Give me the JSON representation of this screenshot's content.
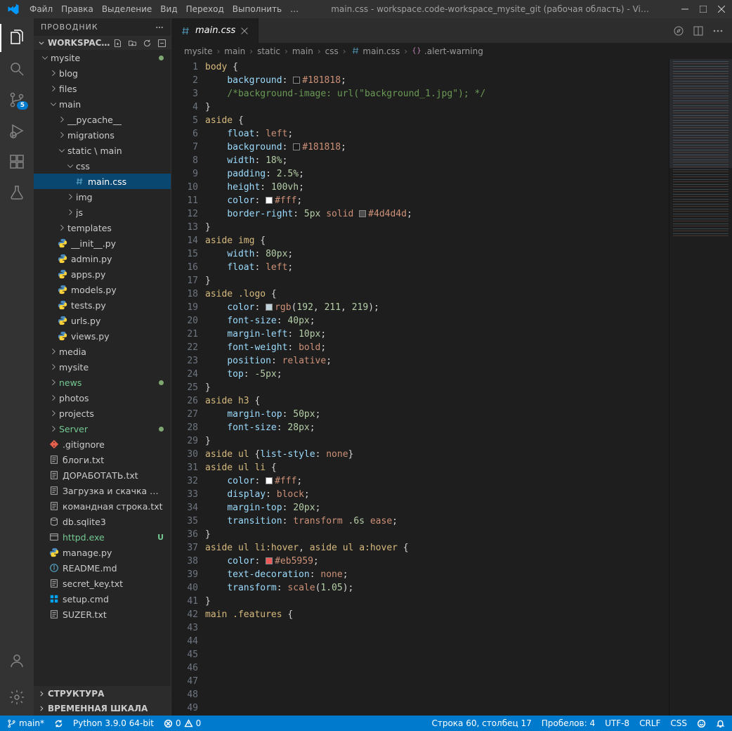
{
  "titlebar": {
    "menus": [
      "Файл",
      "Правка",
      "Выделение",
      "Вид",
      "Переход",
      "Выполнить",
      "…"
    ],
    "title": "main.css - workspace.code-workspace_mysite_git (рабочая область) - Vi…"
  },
  "activity": {
    "scm_badge": "5"
  },
  "sidebar": {
    "title": "ПРОВОДНИК",
    "workspace_label": "WORKSPAC…",
    "tree": [
      {
        "indent": 0,
        "type": "folder-open",
        "label": "mysite",
        "mod": true
      },
      {
        "indent": 1,
        "type": "folder",
        "label": "blog"
      },
      {
        "indent": 1,
        "type": "folder",
        "label": "files"
      },
      {
        "indent": 1,
        "type": "folder-open",
        "label": "main"
      },
      {
        "indent": 2,
        "type": "folder",
        "label": "__pycache__"
      },
      {
        "indent": 2,
        "type": "folder",
        "label": "migrations"
      },
      {
        "indent": 2,
        "type": "folder-open",
        "label": "static \\ main"
      },
      {
        "indent": 3,
        "type": "folder-open",
        "label": "css"
      },
      {
        "indent": 4,
        "type": "file",
        "icon": "css",
        "label": "main.css",
        "selected": true
      },
      {
        "indent": 3,
        "type": "folder",
        "label": "img"
      },
      {
        "indent": 3,
        "type": "folder",
        "label": "js"
      },
      {
        "indent": 2,
        "type": "folder",
        "label": "templates"
      },
      {
        "indent": 2,
        "type": "file",
        "icon": "py",
        "label": "__init__.py"
      },
      {
        "indent": 2,
        "type": "file",
        "icon": "py",
        "label": "admin.py"
      },
      {
        "indent": 2,
        "type": "file",
        "icon": "py",
        "label": "apps.py"
      },
      {
        "indent": 2,
        "type": "file",
        "icon": "py",
        "label": "models.py"
      },
      {
        "indent": 2,
        "type": "file",
        "icon": "py",
        "label": "tests.py"
      },
      {
        "indent": 2,
        "type": "file",
        "icon": "py",
        "label": "urls.py"
      },
      {
        "indent": 2,
        "type": "file",
        "icon": "py",
        "label": "views.py"
      },
      {
        "indent": 1,
        "type": "folder",
        "label": "media"
      },
      {
        "indent": 1,
        "type": "folder",
        "label": "mysite"
      },
      {
        "indent": 1,
        "type": "folder",
        "label": "news",
        "green": true,
        "mod": true
      },
      {
        "indent": 1,
        "type": "folder",
        "label": "photos"
      },
      {
        "indent": 1,
        "type": "folder",
        "label": "projects"
      },
      {
        "indent": 1,
        "type": "folder",
        "label": "Server",
        "green": true,
        "mod": true
      },
      {
        "indent": 1,
        "type": "file",
        "icon": "git",
        "label": ".gitignore"
      },
      {
        "indent": 1,
        "type": "file",
        "icon": "txt",
        "label": "блоги.txt"
      },
      {
        "indent": 1,
        "type": "file",
        "icon": "txt",
        "label": "ДОРАБОТАТЬ.txt"
      },
      {
        "indent": 1,
        "type": "file",
        "icon": "txt",
        "label": "Загрузка и скачка карт…"
      },
      {
        "indent": 1,
        "type": "file",
        "icon": "txt",
        "label": "командная строка.txt"
      },
      {
        "indent": 1,
        "type": "file",
        "icon": "db",
        "label": "db.sqlite3"
      },
      {
        "indent": 1,
        "type": "file",
        "icon": "exe",
        "label": "httpd.exe",
        "green": true,
        "utag": "U"
      },
      {
        "indent": 1,
        "type": "file",
        "icon": "py",
        "label": "manage.py"
      },
      {
        "indent": 1,
        "type": "file",
        "icon": "info",
        "label": "README.md"
      },
      {
        "indent": 1,
        "type": "file",
        "icon": "txt",
        "label": "secret_key.txt"
      },
      {
        "indent": 1,
        "type": "file",
        "icon": "win",
        "label": "setup.cmd"
      },
      {
        "indent": 1,
        "type": "file",
        "icon": "txt",
        "label": "SUZER.txt"
      }
    ],
    "outline": "СТРУКТУРА",
    "timeline": "ВРЕМЕННАЯ ШКАЛА"
  },
  "tab": {
    "label": "main.css"
  },
  "breadcrumbs": [
    "mysite",
    "main",
    "static",
    "main",
    "css",
    "main.css",
    ".alert-warning"
  ],
  "code": {
    "start": 1,
    "lines": [
      [
        {
          "c": "sel",
          "t": "body"
        },
        {
          "c": "text",
          "t": " {"
        }
      ],
      [
        {
          "c": "text",
          "t": "    "
        },
        {
          "c": "prop",
          "t": "background"
        },
        {
          "c": "text",
          "t": ": "
        },
        {
          "sw": "#181818"
        },
        {
          "c": "val",
          "t": "#181818"
        },
        {
          "c": "text",
          "t": ";"
        }
      ],
      [
        {
          "c": "text",
          "t": "    "
        },
        {
          "c": "comm",
          "t": "/*background-image: url(\"background_1.jpg\"); */"
        }
      ],
      [
        {
          "c": "text",
          "t": "}"
        }
      ],
      [],
      [
        {
          "c": "sel",
          "t": "aside"
        },
        {
          "c": "text",
          "t": " {"
        }
      ],
      [
        {
          "c": "text",
          "t": "    "
        },
        {
          "c": "prop",
          "t": "float"
        },
        {
          "c": "text",
          "t": ": "
        },
        {
          "c": "val",
          "t": "left"
        },
        {
          "c": "text",
          "t": ";"
        }
      ],
      [
        {
          "c": "text",
          "t": "    "
        },
        {
          "c": "prop",
          "t": "background"
        },
        {
          "c": "text",
          "t": ": "
        },
        {
          "sw": "#181818"
        },
        {
          "c": "val",
          "t": "#181818"
        },
        {
          "c": "text",
          "t": ";"
        }
      ],
      [
        {
          "c": "text",
          "t": "    "
        },
        {
          "c": "prop",
          "t": "width"
        },
        {
          "c": "text",
          "t": ": "
        },
        {
          "c": "num",
          "t": "18%"
        },
        {
          "c": "text",
          "t": ";"
        }
      ],
      [
        {
          "c": "text",
          "t": "    "
        },
        {
          "c": "prop",
          "t": "padding"
        },
        {
          "c": "text",
          "t": ": "
        },
        {
          "c": "num",
          "t": "2.5%"
        },
        {
          "c": "text",
          "t": ";"
        }
      ],
      [
        {
          "c": "text",
          "t": "    "
        },
        {
          "c": "prop",
          "t": "height"
        },
        {
          "c": "text",
          "t": ": "
        },
        {
          "c": "num",
          "t": "100vh"
        },
        {
          "c": "text",
          "t": ";"
        }
      ],
      [
        {
          "c": "text",
          "t": "    "
        },
        {
          "c": "prop",
          "t": "color"
        },
        {
          "c": "text",
          "t": ": "
        },
        {
          "sw": "#ffffff"
        },
        {
          "c": "val",
          "t": "#fff"
        },
        {
          "c": "text",
          "t": ";"
        }
      ],
      [
        {
          "c": "text",
          "t": "    "
        },
        {
          "c": "prop",
          "t": "border-right"
        },
        {
          "c": "text",
          "t": ": "
        },
        {
          "c": "num",
          "t": "5px"
        },
        {
          "c": "text",
          "t": " "
        },
        {
          "c": "val",
          "t": "solid"
        },
        {
          "c": "text",
          "t": " "
        },
        {
          "sw": "#4d4d4d"
        },
        {
          "c": "val",
          "t": "#4d4d4d"
        },
        {
          "c": "text",
          "t": ";"
        }
      ],
      [
        {
          "c": "text",
          "t": "}"
        }
      ],
      [],
      [
        {
          "c": "sel",
          "t": "aside"
        },
        {
          "c": "text",
          "t": " "
        },
        {
          "c": "sel",
          "t": "img"
        },
        {
          "c": "text",
          "t": " {"
        }
      ],
      [
        {
          "c": "text",
          "t": "    "
        },
        {
          "c": "prop",
          "t": "width"
        },
        {
          "c": "text",
          "t": ": "
        },
        {
          "c": "num",
          "t": "80px"
        },
        {
          "c": "text",
          "t": ";"
        }
      ],
      [
        {
          "c": "text",
          "t": "    "
        },
        {
          "c": "prop",
          "t": "float"
        },
        {
          "c": "text",
          "t": ": "
        },
        {
          "c": "val",
          "t": "left"
        },
        {
          "c": "text",
          "t": ";"
        }
      ],
      [
        {
          "c": "text",
          "t": "}"
        }
      ],
      [],
      [
        {
          "c": "sel",
          "t": "aside"
        },
        {
          "c": "text",
          "t": " "
        },
        {
          "c": "sel",
          "t": ".logo"
        },
        {
          "c": "text",
          "t": " {"
        }
      ],
      [
        {
          "c": "text",
          "t": "    "
        },
        {
          "c": "prop",
          "t": "color"
        },
        {
          "c": "text",
          "t": ": "
        },
        {
          "sw": "#c0d3db"
        },
        {
          "c": "val",
          "t": "rgb"
        },
        {
          "c": "text",
          "t": "("
        },
        {
          "c": "num",
          "t": "192"
        },
        {
          "c": "text",
          "t": ", "
        },
        {
          "c": "num",
          "t": "211"
        },
        {
          "c": "text",
          "t": ", "
        },
        {
          "c": "num",
          "t": "219"
        },
        {
          "c": "text",
          "t": ");"
        }
      ],
      [
        {
          "c": "text",
          "t": "    "
        },
        {
          "c": "prop",
          "t": "font-size"
        },
        {
          "c": "text",
          "t": ": "
        },
        {
          "c": "num",
          "t": "40px"
        },
        {
          "c": "text",
          "t": ";"
        }
      ],
      [
        {
          "c": "text",
          "t": "    "
        },
        {
          "c": "prop",
          "t": "margin-left"
        },
        {
          "c": "text",
          "t": ": "
        },
        {
          "c": "num",
          "t": "10px"
        },
        {
          "c": "text",
          "t": ";"
        }
      ],
      [
        {
          "c": "text",
          "t": "    "
        },
        {
          "c": "prop",
          "t": "font-weight"
        },
        {
          "c": "text",
          "t": ": "
        },
        {
          "c": "val",
          "t": "bold"
        },
        {
          "c": "text",
          "t": ";"
        }
      ],
      [
        {
          "c": "text",
          "t": "    "
        },
        {
          "c": "prop",
          "t": "position"
        },
        {
          "c": "text",
          "t": ": "
        },
        {
          "c": "val",
          "t": "relative"
        },
        {
          "c": "text",
          "t": ";"
        }
      ],
      [
        {
          "c": "text",
          "t": "    "
        },
        {
          "c": "prop",
          "t": "top"
        },
        {
          "c": "text",
          "t": ": "
        },
        {
          "c": "num",
          "t": "-5px"
        },
        {
          "c": "text",
          "t": ";"
        }
      ],
      [
        {
          "c": "text",
          "t": "}"
        }
      ],
      [],
      [
        {
          "c": "sel",
          "t": "aside"
        },
        {
          "c": "text",
          "t": " "
        },
        {
          "c": "sel",
          "t": "h3"
        },
        {
          "c": "text",
          "t": " {"
        }
      ],
      [
        {
          "c": "text",
          "t": "    "
        },
        {
          "c": "prop",
          "t": "margin-top"
        },
        {
          "c": "text",
          "t": ": "
        },
        {
          "c": "num",
          "t": "50px"
        },
        {
          "c": "text",
          "t": ";"
        }
      ],
      [
        {
          "c": "text",
          "t": "    "
        },
        {
          "c": "prop",
          "t": "font-size"
        },
        {
          "c": "text",
          "t": ": "
        },
        {
          "c": "num",
          "t": "28px"
        },
        {
          "c": "text",
          "t": ";"
        }
      ],
      [
        {
          "c": "text",
          "t": "}"
        }
      ],
      [],
      [
        {
          "c": "sel",
          "t": "aside"
        },
        {
          "c": "text",
          "t": " "
        },
        {
          "c": "sel",
          "t": "ul"
        },
        {
          "c": "text",
          "t": " {"
        },
        {
          "c": "prop",
          "t": "list-style"
        },
        {
          "c": "text",
          "t": ": "
        },
        {
          "c": "val",
          "t": "none"
        },
        {
          "c": "text",
          "t": "}"
        }
      ],
      [
        {
          "c": "sel",
          "t": "aside"
        },
        {
          "c": "text",
          "t": " "
        },
        {
          "c": "sel",
          "t": "ul"
        },
        {
          "c": "text",
          "t": " "
        },
        {
          "c": "sel",
          "t": "li"
        },
        {
          "c": "text",
          "t": " {"
        }
      ],
      [
        {
          "c": "text",
          "t": "    "
        },
        {
          "c": "prop",
          "t": "color"
        },
        {
          "c": "text",
          "t": ": "
        },
        {
          "sw": "#ffffff"
        },
        {
          "c": "val",
          "t": "#fff"
        },
        {
          "c": "text",
          "t": ";"
        }
      ],
      [
        {
          "c": "text",
          "t": "    "
        },
        {
          "c": "prop",
          "t": "display"
        },
        {
          "c": "text",
          "t": ": "
        },
        {
          "c": "val",
          "t": "block"
        },
        {
          "c": "text",
          "t": ";"
        }
      ],
      [
        {
          "c": "text",
          "t": "    "
        },
        {
          "c": "prop",
          "t": "margin-top"
        },
        {
          "c": "text",
          "t": ": "
        },
        {
          "c": "num",
          "t": "20px"
        },
        {
          "c": "text",
          "t": ";"
        }
      ],
      [
        {
          "c": "text",
          "t": "    "
        },
        {
          "c": "prop",
          "t": "transition"
        },
        {
          "c": "text",
          "t": ": "
        },
        {
          "c": "val",
          "t": "transform"
        },
        {
          "c": "text",
          "t": " "
        },
        {
          "c": "num",
          "t": ".6s"
        },
        {
          "c": "text",
          "t": " "
        },
        {
          "c": "val",
          "t": "ease"
        },
        {
          "c": "text",
          "t": ";"
        }
      ],
      [
        {
          "c": "text",
          "t": "}"
        }
      ],
      [],
      [
        {
          "c": "sel",
          "t": "aside"
        },
        {
          "c": "text",
          "t": " "
        },
        {
          "c": "sel",
          "t": "ul"
        },
        {
          "c": "text",
          "t": " "
        },
        {
          "c": "sel",
          "t": "li:hover"
        },
        {
          "c": "text",
          "t": ", "
        },
        {
          "c": "sel",
          "t": "aside"
        },
        {
          "c": "text",
          "t": " "
        },
        {
          "c": "sel",
          "t": "ul"
        },
        {
          "c": "text",
          "t": " "
        },
        {
          "c": "sel",
          "t": "a:hover"
        },
        {
          "c": "text",
          "t": " {"
        }
      ],
      [
        {
          "c": "text",
          "t": "    "
        },
        {
          "c": "prop",
          "t": "color"
        },
        {
          "c": "text",
          "t": ": "
        },
        {
          "sw": "#eb5959"
        },
        {
          "c": "val",
          "t": "#eb5959"
        },
        {
          "c": "text",
          "t": ";"
        }
      ],
      [
        {
          "c": "text",
          "t": "    "
        },
        {
          "c": "prop",
          "t": "text-decoration"
        },
        {
          "c": "text",
          "t": ": "
        },
        {
          "c": "val",
          "t": "none"
        },
        {
          "c": "text",
          "t": ";"
        }
      ],
      [
        {
          "c": "text",
          "t": "    "
        },
        {
          "c": "prop",
          "t": "transform"
        },
        {
          "c": "text",
          "t": ": "
        },
        {
          "c": "val",
          "t": "scale"
        },
        {
          "c": "text",
          "t": "("
        },
        {
          "c": "num",
          "t": "1.05"
        },
        {
          "c": "text",
          "t": ");"
        }
      ],
      [
        {
          "c": "text",
          "t": "}"
        }
      ],
      [],
      [
        {
          "c": "sel",
          "t": "main"
        },
        {
          "c": "text",
          "t": " "
        },
        {
          "c": "sel",
          "t": ".features"
        },
        {
          "c": "text",
          "t": " {"
        }
      ]
    ]
  },
  "statusbar": {
    "branch": "main*",
    "python": "Python 3.9.0 64-bit",
    "problems_err": "0",
    "problems_warn": "0",
    "cursor": "Строка 60, столбец 17",
    "spaces": "Пробелов: 4",
    "encoding": "UTF-8",
    "eol": "CRLF",
    "lang": "CSS"
  }
}
